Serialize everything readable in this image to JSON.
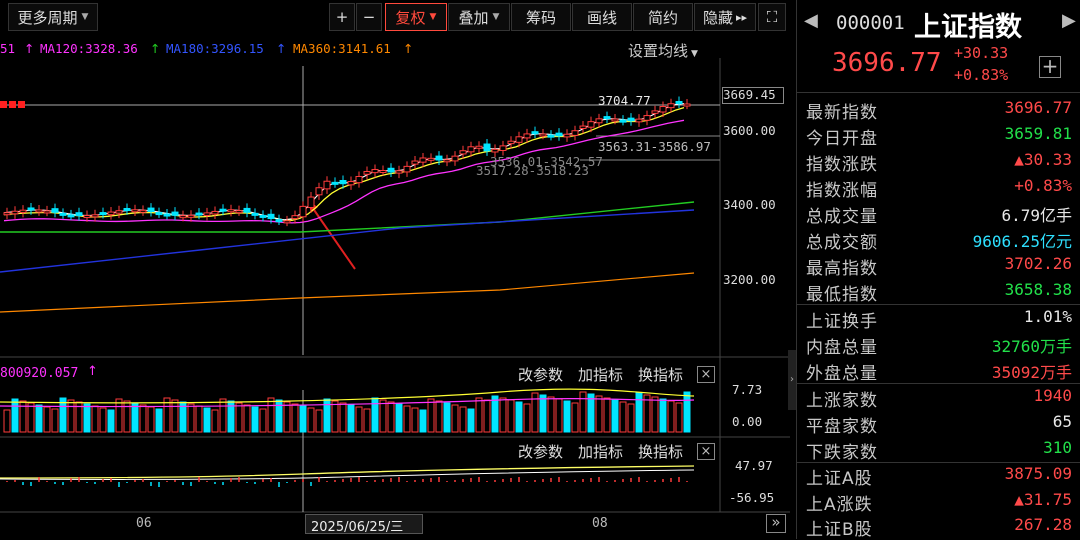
{
  "toolbar": {
    "period_label": "更多周期",
    "zoom_in": "+",
    "zoom_out": "−",
    "fuquan": "复权",
    "overlay": "叠加",
    "chips": "筹码",
    "draw": "画线",
    "simple": "简约",
    "hide": "隐藏",
    "hide_arrow": "▸▸",
    "fullscreen": "⛶"
  },
  "ma_legend": {
    "ma_prev": "51",
    "ma120": "MA120:3328.36",
    "ma180": "MA180:3296.15",
    "ma360": "MA360:3141.61",
    "settings": "设置均线"
  },
  "price_axis": {
    "current": "3669.45",
    "ticks": [
      "3600.00",
      "3400.00",
      "3200.00"
    ]
  },
  "annotations": {
    "high": "3704.77",
    "range1": "3563.31-3586.97",
    "range2": "3536.01-3542.57",
    "range3": "3517.28-3518.23"
  },
  "vol_panel": {
    "legend": "800920.057",
    "max": "7.73",
    "min": "0.00",
    "params": "改参数",
    "add": "加指标",
    "switch": "换指标",
    "close": "×"
  },
  "ind_panel": {
    "max": "47.97",
    "min": "-56.95",
    "params": "改参数",
    "add": "加指标",
    "switch": "换指标",
    "close": "×"
  },
  "time_axis": {
    "left": "06",
    "cursor": "2025/06/25/三",
    "right": "08",
    "scroll": "»"
  },
  "quote": {
    "code": "000001",
    "name": "上证指数",
    "price": "3696.77",
    "change": "+30.33",
    "change_pct": "+0.83%",
    "add_label": "+"
  },
  "stats": [
    {
      "label": "最新指数",
      "value": "3696.77",
      "color": "red"
    },
    {
      "label": "今日开盘",
      "value": "3659.81",
      "color": "green"
    },
    {
      "label": "指数涨跌",
      "value": "▲30.33",
      "color": "red"
    },
    {
      "label": "指数涨幅",
      "value": "+0.83%",
      "color": "red"
    },
    {
      "label": "总成交量",
      "value": "6.79亿手",
      "color": "white"
    },
    {
      "label": "总成交额",
      "value": "9606.25亿元",
      "color": "cyan"
    },
    {
      "label": "最高指数",
      "value": "3702.26",
      "color": "red"
    },
    {
      "label": "最低指数",
      "value": "3658.38",
      "color": "green"
    },
    {
      "label": "上证换手",
      "value": "1.01%",
      "color": "white"
    },
    {
      "label": "内盘总量",
      "value": "32760万手",
      "color": "green"
    },
    {
      "label": "外盘总量",
      "value": "35092万手",
      "color": "red"
    },
    {
      "label": "上涨家数",
      "value": "1940",
      "color": "red"
    },
    {
      "label": "平盘家数",
      "value": "65",
      "color": "white"
    },
    {
      "label": "下跌家数",
      "value": "310",
      "color": "green"
    },
    {
      "label": "上证A股",
      "value": "3875.09",
      "color": "red"
    },
    {
      "label": "上A涨跌",
      "value": "▲31.75",
      "color": "red"
    },
    {
      "label": "上证B股",
      "value": "267.28",
      "color": "red"
    }
  ],
  "colors": {
    "up": "#ff3b3b",
    "down": "#00e5ff",
    "ma5": "#ffffff",
    "ma10": "#ffff33",
    "ma20": "#ff33ff",
    "ma60": "#22cc22",
    "ma120": "#2233dd",
    "ma360": "#ff8800"
  }
}
